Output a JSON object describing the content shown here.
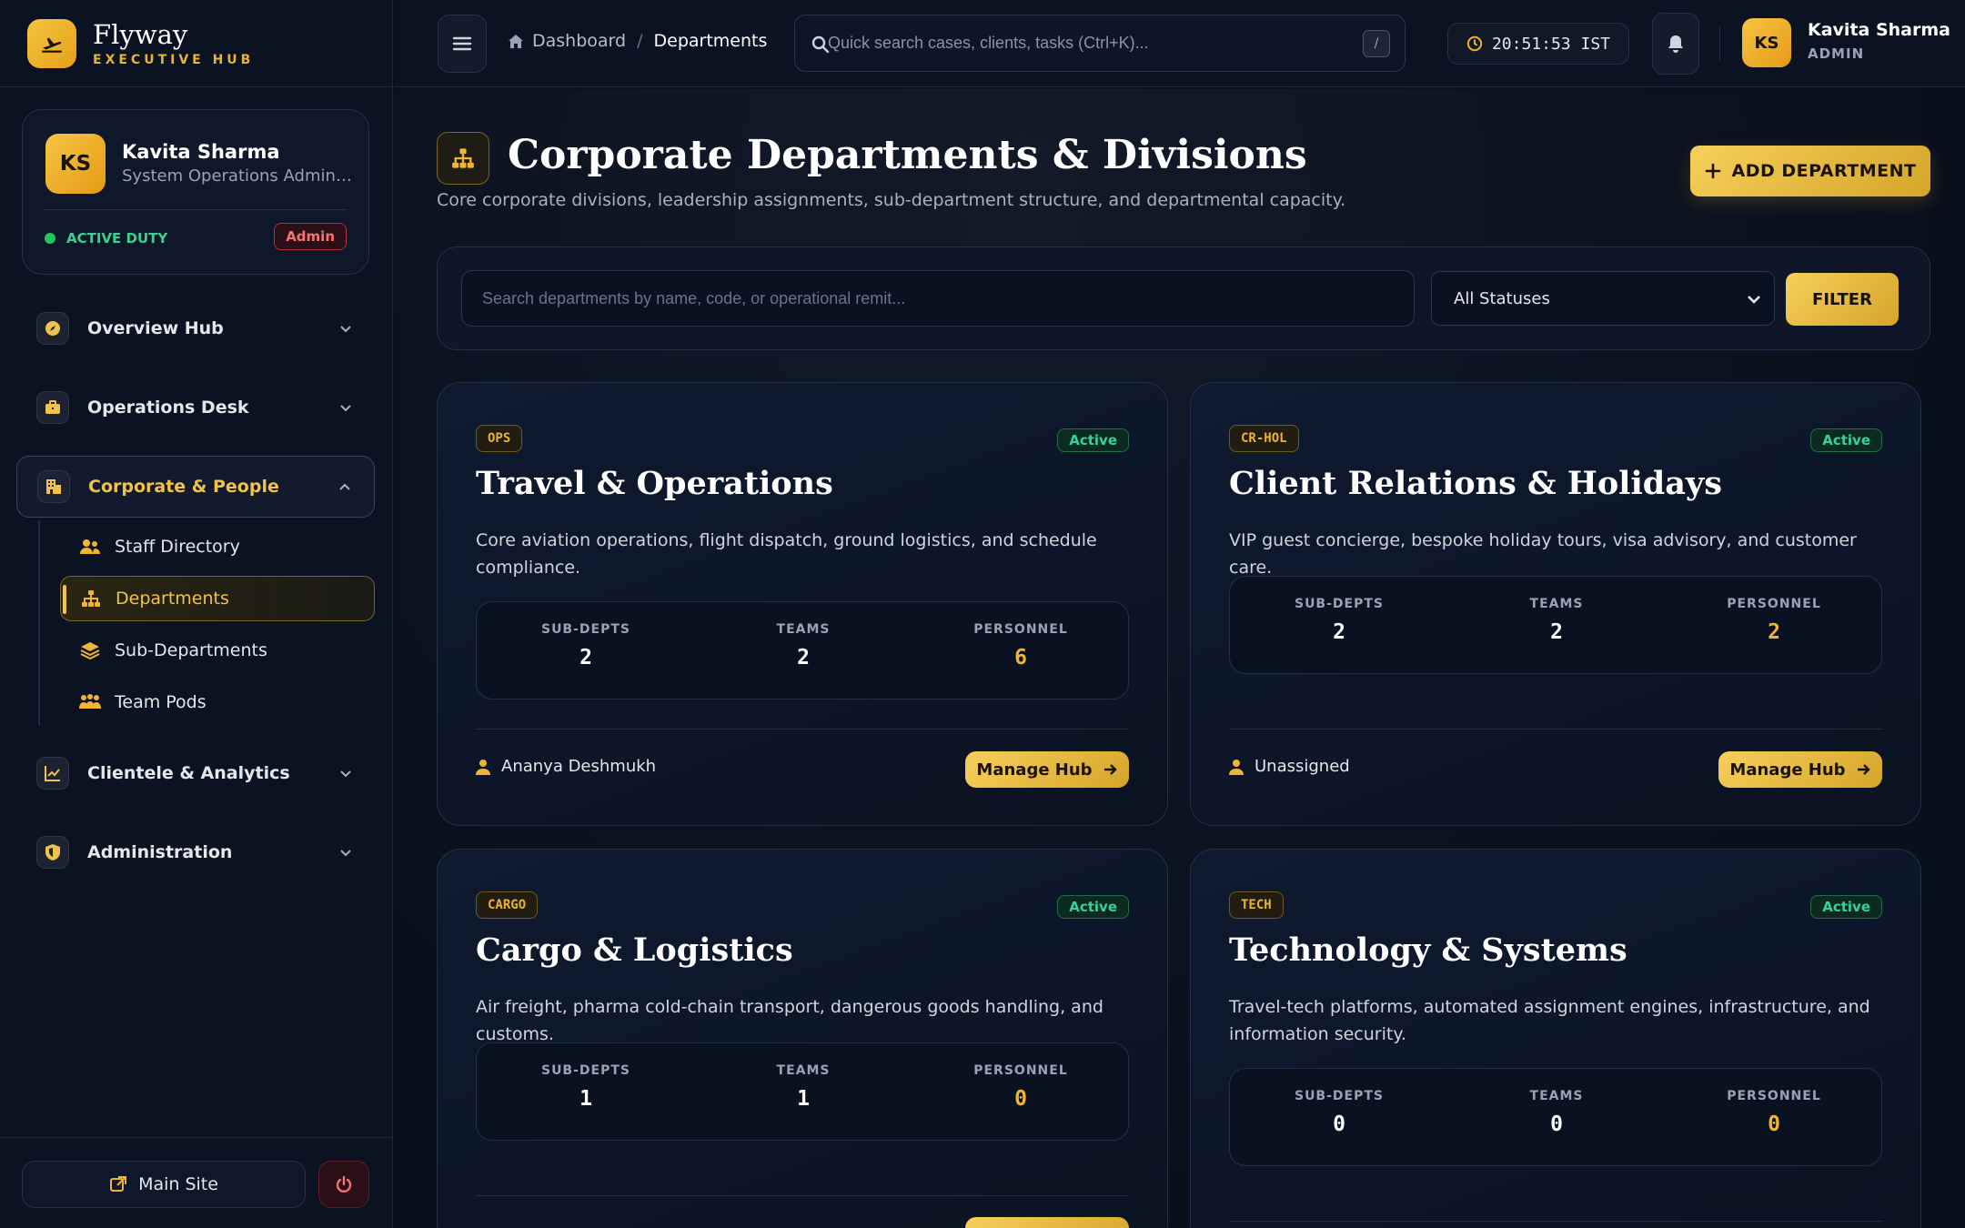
{
  "brand": {
    "name": "Flyway",
    "subtitle": "EXECUTIVE HUB"
  },
  "profile": {
    "initials": "KS",
    "name": "Kavita Sharma",
    "role": "System Operations Administrator",
    "duty": "ACTIVE DUTY",
    "badge": "Admin"
  },
  "nav": {
    "overview": "Overview Hub",
    "operations": "Operations Desk",
    "corporate": "Corporate & People",
    "clientele": "Clientele & Analytics",
    "administration": "Administration",
    "sub": [
      "Staff Directory",
      "Departments",
      "Sub-Departments",
      "Team Pods"
    ]
  },
  "sidebar_footer": {
    "main_site": "Main Site"
  },
  "topbar": {
    "breadcrumb_home": "Dashboard",
    "breadcrumb_sep": "/",
    "breadcrumb_current": "Departments",
    "search_placeholder": "Quick search cases, clients, tasks (Ctrl+K)...",
    "search_shortcut": "/",
    "clock": "20:51:53 IST",
    "user_initials": "KS",
    "user_name": "Kavita Sharma",
    "user_role": "ADMIN"
  },
  "page": {
    "title": "Corporate Departments & Divisions",
    "subtitle": "Core corporate divisions, leadership assignments, sub-department structure, and departmental capacity.",
    "add_button": "ADD DEPARTMENT"
  },
  "filter": {
    "search_placeholder": "Search departments by name, code, or operational remit...",
    "status_selected": "All Statuses",
    "button": "FILTER"
  },
  "stat_labels": {
    "sub": "SUB-DEPTS",
    "teams": "TEAMS",
    "personnel": "PERSONNEL"
  },
  "departments": [
    {
      "code": "OPS",
      "status": "Active",
      "title": "Travel & Operations",
      "description": "Core aviation operations, flight dispatch, ground logistics, and schedule compliance.",
      "sub_depts": "2",
      "teams": "2",
      "personnel": "6",
      "lead": "Ananya Deshmukh",
      "action": "Manage Hub"
    },
    {
      "code": "CR-HOL",
      "status": "Active",
      "title": "Client Relations & Holidays",
      "description": "VIP guest concierge, bespoke holiday tours, visa advisory, and customer care.",
      "sub_depts": "2",
      "teams": "2",
      "personnel": "2",
      "lead": "Unassigned",
      "action": "Manage Hub"
    },
    {
      "code": "CARGO",
      "status": "Active",
      "title": "Cargo & Logistics",
      "description": "Air freight, pharma cold-chain transport, dangerous goods handling, and customs.",
      "sub_depts": "1",
      "teams": "1",
      "personnel": "0",
      "lead": "",
      "action": ""
    },
    {
      "code": "TECH",
      "status": "Active",
      "title": "Technology & Systems",
      "description": "Travel-tech platforms, automated assignment engines, infrastructure, and information security.",
      "sub_depts": "0",
      "teams": "0",
      "personnel": "0",
      "lead": "",
      "action": ""
    }
  ],
  "colors": {
    "accent_gold": "#f2c34a",
    "status_green": "#34d399",
    "background": "#0a0f1c",
    "danger": "#f87171"
  },
  "icons": [
    "plane-icon",
    "compass-icon",
    "briefcase-icon",
    "building-icon",
    "chevron-down-icon",
    "chevron-up-icon",
    "users-icon",
    "sitemap-icon",
    "layers-icon",
    "team-icon",
    "chart-icon",
    "shield-icon",
    "external-link-icon",
    "power-icon",
    "menu-icon",
    "home-icon",
    "search-icon",
    "clock-icon",
    "bell-icon",
    "plus-icon",
    "user-icon",
    "arrow-right-icon"
  ]
}
